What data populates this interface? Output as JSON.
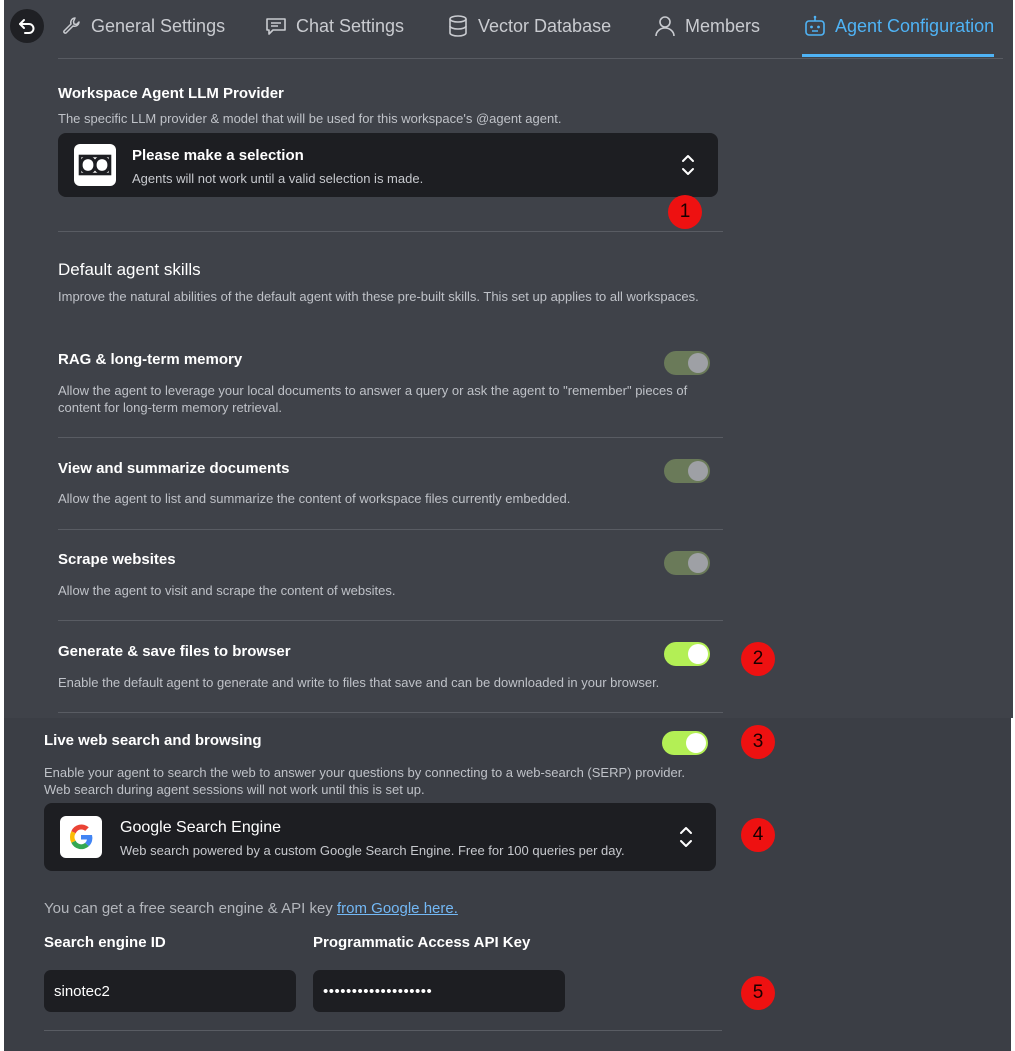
{
  "tabs": [
    {
      "label": "General Settings",
      "icon": "wrench-icon"
    },
    {
      "label": "Chat Settings",
      "icon": "chat-icon"
    },
    {
      "label": "Vector Database",
      "icon": "database-icon"
    },
    {
      "label": "Members",
      "icon": "user-icon"
    },
    {
      "label": "Agent Configuration",
      "icon": "robot-icon",
      "active": true
    }
  ],
  "provider": {
    "title": "Workspace Agent LLM Provider",
    "description": "The specific LLM provider & model that will be used for this workspace's @agent agent.",
    "select_title": "Please make a selection",
    "select_desc": "Agents will not work until a valid selection is made."
  },
  "skills": {
    "title": "Default agent skills",
    "description": "Improve the natural abilities of the default agent with these pre-built skills. This set up applies to all workspaces.",
    "items": [
      {
        "title": "RAG & long-term memory",
        "desc1": "Allow the agent to leverage your local documents to answer a query or ask the agent to \"remember\" pieces of",
        "desc2": "content for long-term memory retrieval.",
        "state": "on-locked"
      },
      {
        "title": "View and summarize documents",
        "desc1": "Allow the agent to list and summarize the content of workspace files currently embedded.",
        "state": "on-locked"
      },
      {
        "title": "Scrape websites",
        "desc1": "Allow the agent to visit and scrape the content of websites.",
        "state": "on-locked"
      },
      {
        "title": "Generate & save files to browser",
        "desc1": "Enable the default agent to generate and write to files that save and can be downloaded in your browser.",
        "state": "on"
      }
    ]
  },
  "web_search": {
    "title": "Live web search and browsing",
    "desc1": "Enable your agent to search the web to answer your questions by connecting to a web-search (SERP) provider.",
    "desc2": "Web search during agent sessions will not work until this is set up.",
    "state": "on",
    "provider_title": "Google Search Engine",
    "provider_desc": "Web search powered by a custom Google Search Engine. Free for 100 queries per day.",
    "hint_prefix": "You can get a free search engine & API key ",
    "hint_link": "from Google here.",
    "engine_id_label": "Search engine ID",
    "engine_id_value": "sinotec2",
    "api_key_label": "Programmatic Access API Key",
    "api_key_value": "•••••••••••••••••••"
  },
  "markers": [
    "1",
    "2",
    "3",
    "4",
    "5"
  ],
  "colors": {
    "accent": "#4fb3f5",
    "toggle_on": "#b3ef55",
    "toggle_locked": "#6a7a59",
    "marker": "#ee1111"
  }
}
